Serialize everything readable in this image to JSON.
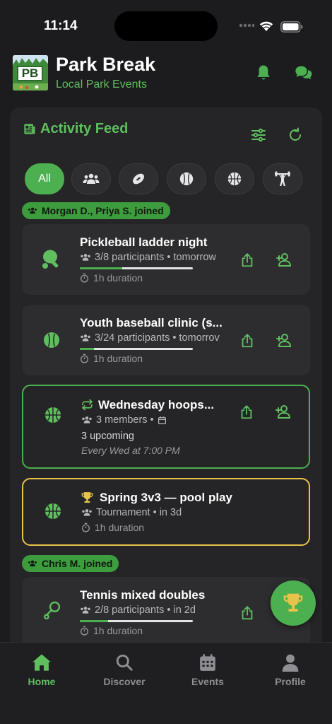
{
  "status_bar": {
    "time": "11:14"
  },
  "app": {
    "logo_text": "PB",
    "title": "Park Break",
    "subtitle": "Local Park Events"
  },
  "feed": {
    "title": "Activity Feed",
    "filters": [
      {
        "label": "All",
        "icon": "all",
        "active": true
      },
      {
        "icon": "group-icon"
      },
      {
        "icon": "football-icon"
      },
      {
        "icon": "baseball-icon"
      },
      {
        "icon": "basketball-icon"
      },
      {
        "icon": "weightlifting-icon"
      }
    ],
    "joined_1": "Morgan D., Priya S. joined",
    "joined_2": "Chris M. joined",
    "cards": [
      {
        "title": "Pickleball ladder night",
        "meta": "3/8 participants • tomorrow",
        "duration": "1h duration",
        "progress": 0.375,
        "icon": "pickleball-icon"
      },
      {
        "title": "Youth baseball clinic (s...",
        "meta": "3/24 participants • tomorrov",
        "duration": "1h duration",
        "progress": 0.125,
        "icon": "baseball-icon"
      },
      {
        "title": "Wednesday hoops...",
        "meta": "3 members •",
        "upcoming": "3 upcoming",
        "schedule": "Every Wed at 7:00 PM",
        "icon": "basketball-icon",
        "title_icon": "repeat-icon"
      },
      {
        "title": "Spring 3v3 — pool play",
        "meta": "Tournament • in 3d",
        "duration": "1h duration",
        "icon": "basketball-icon",
        "title_icon": "trophy-icon"
      },
      {
        "title": "Tennis mixed doubles",
        "meta": "2/8 participants • in 2d",
        "duration": "1h duration",
        "progress": 0.25,
        "icon": "tennis-icon"
      }
    ]
  },
  "tabs": [
    {
      "label": "Home",
      "icon": "home-icon",
      "active": true
    },
    {
      "label": "Discover",
      "icon": "search-icon"
    },
    {
      "label": "Events",
      "icon": "calendar-icon"
    },
    {
      "label": "Profile",
      "icon": "person-icon"
    }
  ],
  "colors": {
    "accent": "#4caf50",
    "accent_text": "#5fbf5f",
    "gold": "#e7c34a",
    "background": "#1c1c1e"
  }
}
